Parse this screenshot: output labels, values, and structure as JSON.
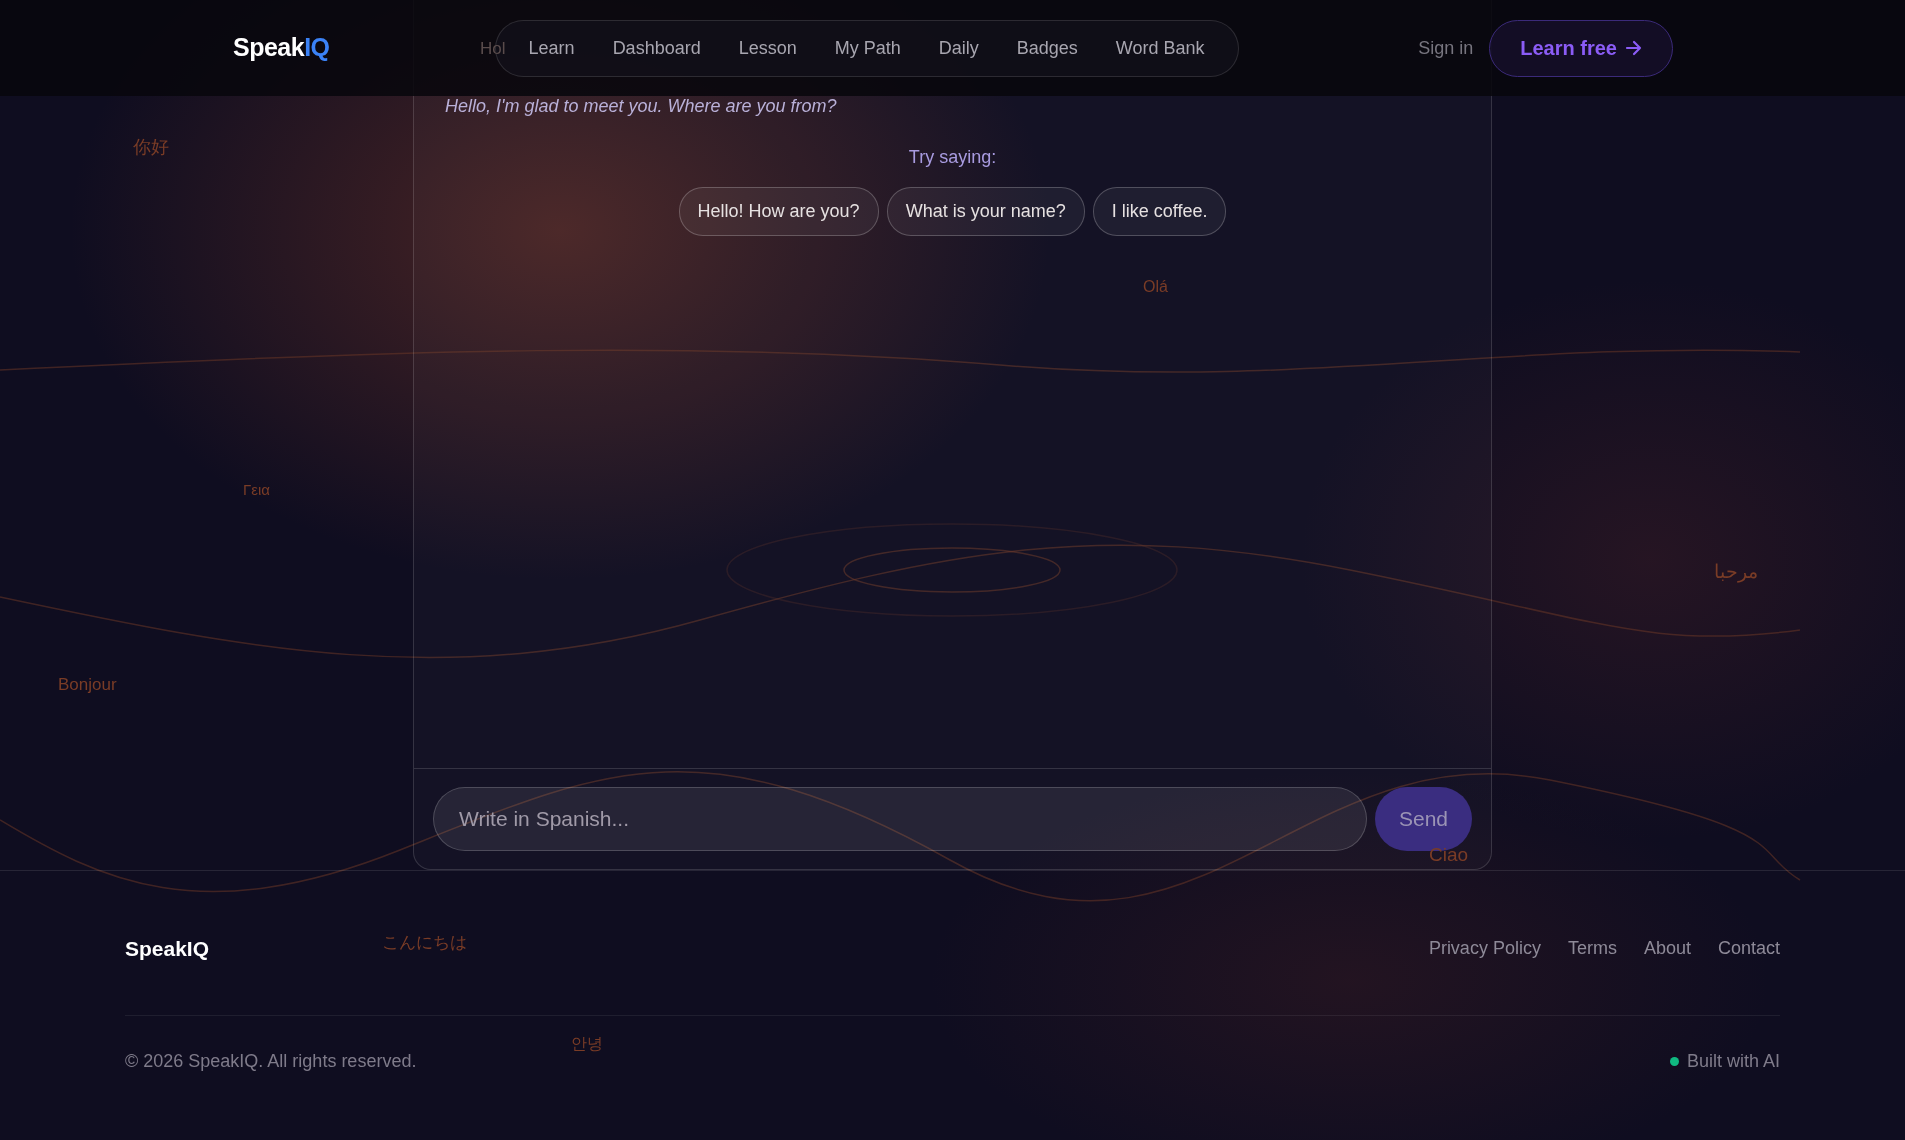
{
  "header": {
    "logo": {
      "main": "Speak",
      "accent": "IQ"
    },
    "nav": [
      "Learn",
      "Dashboard",
      "Lesson",
      "My Path",
      "Daily",
      "Badges",
      "Word Bank"
    ],
    "sign_in": "Sign in",
    "cta": "Learn free"
  },
  "chat": {
    "message": "Hello, I'm glad to meet you. Where are you from?",
    "suggestions_label": "Try saying:",
    "suggestions": [
      "Hello! How are you?",
      "What is your name?",
      "I like coffee."
    ],
    "input": {
      "placeholder": "Write in Spanish..."
    },
    "send": {
      "label": "Send",
      "disabled": true
    }
  },
  "floating_words": [
    "Hol",
    "你好",
    "Γεια",
    "Bonjour",
    "Olá",
    "مرحبا",
    "Ciao",
    "こんにちは",
    "안녕"
  ],
  "footer": {
    "logo": "SpeakIQ",
    "links": [
      "Privacy Policy",
      "Terms",
      "About",
      "Contact"
    ],
    "copyright": "© 2026 SpeakIQ. All rights reserved.",
    "status": {
      "label": "Built with AI",
      "color": "#10b981"
    }
  }
}
